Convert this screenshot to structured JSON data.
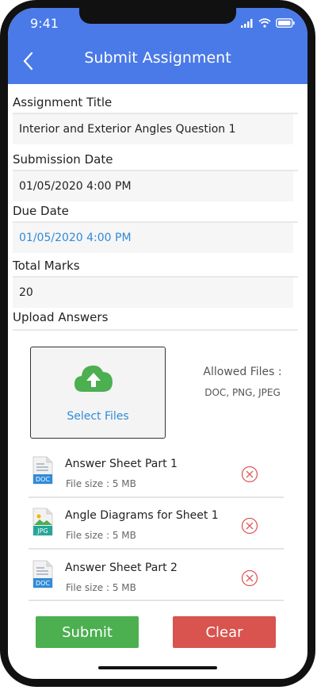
{
  "status_bar": {
    "time": "9:41"
  },
  "header": {
    "title": "Submit Assignment"
  },
  "form": {
    "assignment_title_label": "Assignment Title",
    "assignment_title_value": "Interior and Exterior Angles Question 1",
    "submission_date_label": "Submission Date",
    "submission_date_value": "01/05/2020 4:00 PM",
    "due_date_label": "Due Date",
    "due_date_value": "01/05/2020 4:00 PM",
    "total_marks_label": "Total Marks",
    "total_marks_value": "20",
    "upload_label": "Upload Answers"
  },
  "upload": {
    "select_files": "Select Files",
    "allowed_label": "Allowed Files :",
    "allowed_types": "DOC, PNG, JPEG"
  },
  "files": [
    {
      "name": "Answer Sheet Part 1",
      "size": "File size : 5 MB",
      "type": "DOC"
    },
    {
      "name": "Angle Diagrams for Sheet 1",
      "size": "File size : 5 MB",
      "type": "JPG"
    },
    {
      "name": "Answer Sheet Part 2",
      "size": "File size : 5 MB",
      "type": "DOC"
    }
  ],
  "actions": {
    "submit": "Submit",
    "clear": "Clear"
  },
  "colors": {
    "header": "#4a7ae8",
    "accent": "#2f8bd8",
    "submit": "#4caf50",
    "clear": "#d9534f",
    "cloud": "#4caf50"
  }
}
